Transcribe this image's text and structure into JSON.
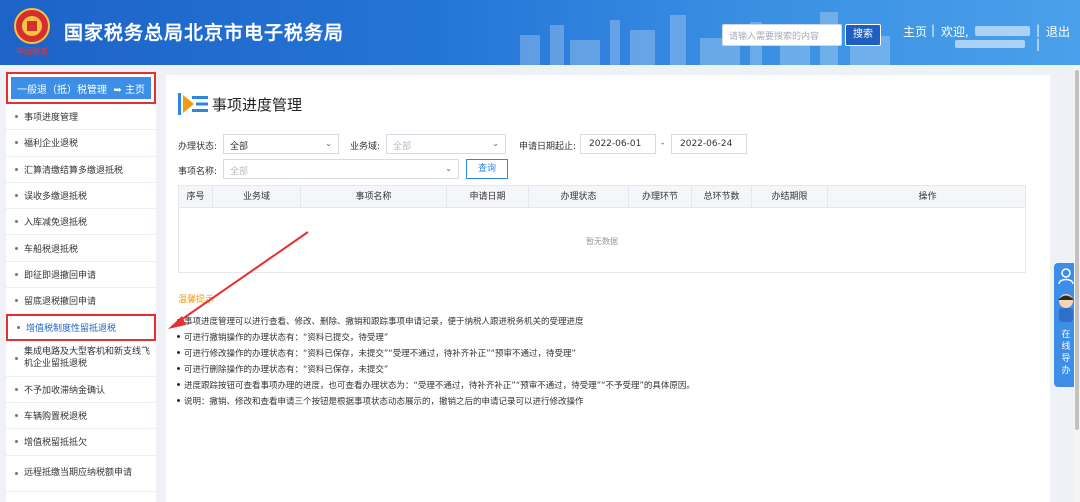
{
  "header": {
    "title": "国家税务总局北京市电子税务局",
    "emblem_caption": "中国税务",
    "search_placeholder": "请输入需要搜索的内容",
    "search_button": "搜索",
    "home_link": "主页",
    "welcome": "欢迎,",
    "logout": "退出",
    "separator": "|"
  },
  "sidebar": {
    "top_label": "一般退（抵）税管理",
    "home_label": "主页",
    "items": [
      {
        "label": "事项进度管理"
      },
      {
        "label": "福利企业退税"
      },
      {
        "label": "汇算清缴结算多缴退抵税"
      },
      {
        "label": "误收多缴退抵税"
      },
      {
        "label": "入库减免退抵税"
      },
      {
        "label": "车船税退抵税"
      },
      {
        "label": "即征即退撤回申请"
      },
      {
        "label": "留底退税撤回申请"
      },
      {
        "label": "增值税制度性留抵退税"
      },
      {
        "label": "集成电路及大型客机和新支线飞机企业留抵退税"
      },
      {
        "label": "不予加收滞纳金确认"
      },
      {
        "label": "车辆购置税退税"
      },
      {
        "label": "增值税留抵抵欠"
      },
      {
        "label": "远程抵缴当期应纳税额申请"
      }
    ]
  },
  "main": {
    "page_title": "事项进度管理",
    "filters": {
      "status_label": "办理状态:",
      "status_value": "全部",
      "domain_label": "业务域:",
      "domain_placeholder": "全部",
      "date_label": "申请日期起止:",
      "date_from": "2022-06-01",
      "date_sep": "-",
      "date_to": "2022-06-24",
      "item_label": "事项名称:",
      "item_placeholder": "全部",
      "query_button": "查询"
    },
    "table": {
      "columns": [
        "序号",
        "业务域",
        "事项名称",
        "申请日期",
        "办理状态",
        "办理环节",
        "总环节数",
        "办结期限",
        "操作"
      ],
      "empty_text": "暂无数据"
    },
    "tips": {
      "title": "温馨提示",
      "lines": [
        "事项进度管理可以进行查看、修改、删除、撤销和跟踪事项申请记录，便于纳税人跟进税务机关的受理进度",
        "可进行撤销操作的办理状态有：“资料已提交，待受理”",
        "可进行修改操作的办理状态有：“资料已保存，未提交”“受理不通过，待补齐补正”“预审不通过，待受理”",
        "可进行删除操作的办理状态有：“资料已保存，未提交”",
        "进度跟踪按钮可查看事项办理的进度，也可查看办理状态为：“受理不通过，待补齐补正”“预审不通过，待受理”“不予受理”的具体原因。",
        "说明：撤销、修改和查看申请三个按钮是根据事项状态动态展示的，撤销之后的申请记录可以进行修改操作"
      ]
    }
  },
  "float_widget": {
    "label": "在线导办"
  },
  "colors": {
    "header_blue": "#2474d6",
    "accent": "#3d8ee6",
    "highlight_red": "#e63030",
    "tip_orange": "#f39c12"
  }
}
